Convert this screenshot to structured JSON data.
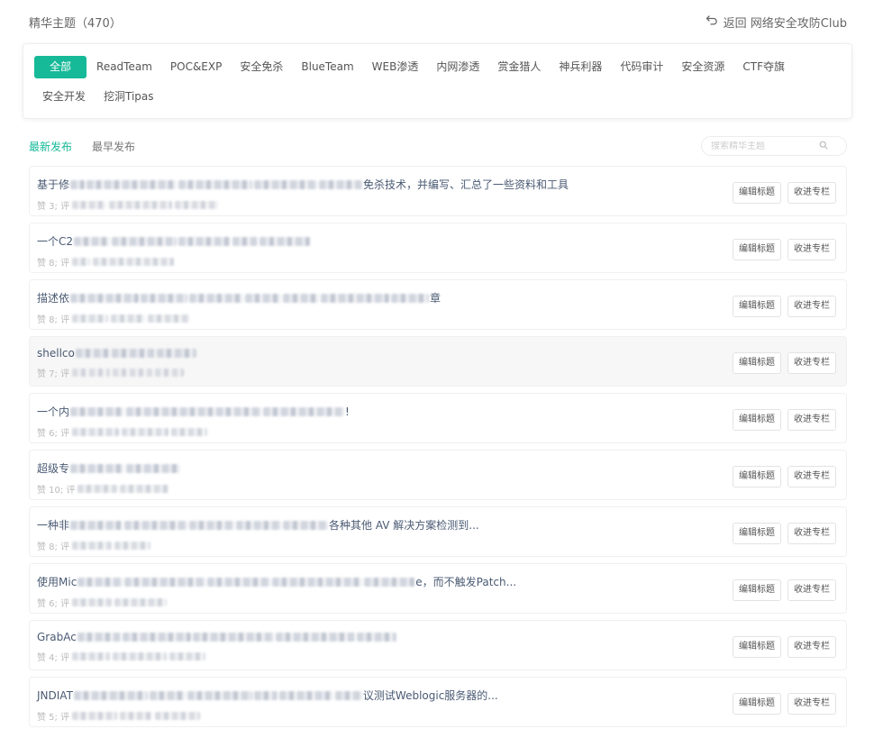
{
  "header": {
    "title": "精华主题（470）",
    "back_label": "返回 网络安全攻防Club"
  },
  "tags": [
    "全部",
    "ReadTeam",
    "POC&EXP",
    "安全免杀",
    "BlueTeam",
    "WEB渗透",
    "内网渗透",
    "赏金猎人",
    "神兵利器",
    "代码审计",
    "安全资源",
    "CTF夺旗",
    "安全开发",
    "挖洞Tipas"
  ],
  "active_tag": "全部",
  "sort": {
    "newest": "最新发布",
    "oldest": "最早发布"
  },
  "search": {
    "placeholder": "搜索精华主题"
  },
  "actions": {
    "edit_title": "编辑标题",
    "add_to_column": "收进专栏"
  },
  "topics": [
    {
      "title_start": "基于修",
      "title_end": "免杀技术，并编写、汇总了一些资料和工具",
      "meta": "赞 3; 评"
    },
    {
      "title_start": "一个C2",
      "title_end": "",
      "meta": "赞 8; 评"
    },
    {
      "title_start": "描述依",
      "title_end": "章",
      "meta": "赞 8; 评"
    },
    {
      "title_start": "shellco",
      "title_end": "",
      "meta": "赞 7; 评"
    },
    {
      "title_start": "一个内",
      "title_end": "!",
      "meta": "赞 6; 评"
    },
    {
      "title_start": "超级专",
      "title_end": "",
      "meta": "赞 10; 评"
    },
    {
      "title_start": "一种非",
      "title_end": "各种其他 AV 解决方案检测到...",
      "meta": "赞 8; 评"
    },
    {
      "title_start": "使用Mic",
      "title_end": "e，而不触发Patch...",
      "meta": "赞 6; 评"
    },
    {
      "title_start": "GrabAc",
      "title_end": "",
      "meta": "赞 4; 评"
    },
    {
      "title_start": "JNDIAT",
      "title_end": "议测试Weblogic服务器的...",
      "meta": "赞 5; 评"
    }
  ],
  "colors": {
    "accent": "#16b998",
    "title_text": "#4a5a73"
  }
}
